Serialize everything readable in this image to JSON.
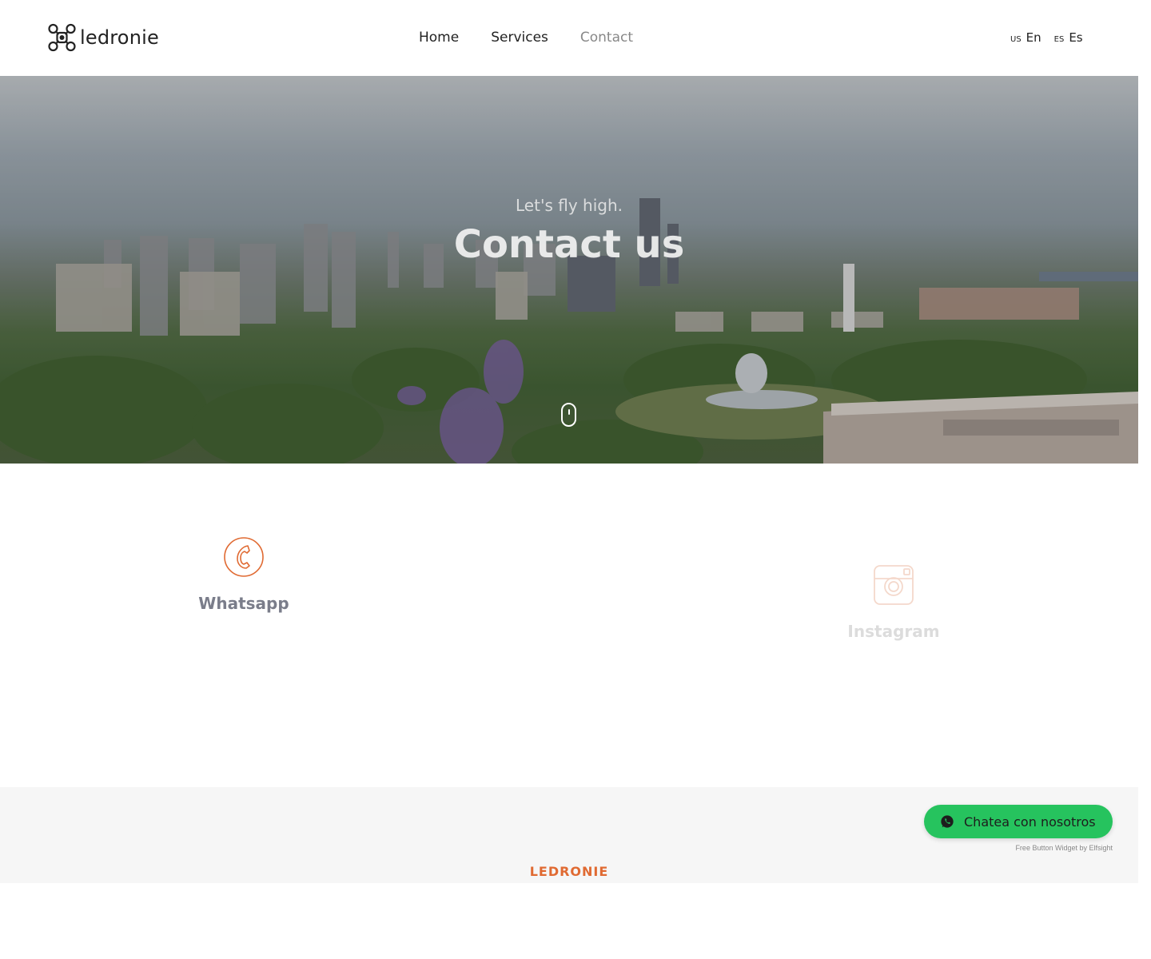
{
  "header": {
    "brand": "ledronie",
    "nav": [
      {
        "label": "Home",
        "active": false
      },
      {
        "label": "Services",
        "active": false
      },
      {
        "label": "Contact",
        "active": true
      }
    ],
    "languages": [
      {
        "code": "US",
        "label": "En"
      },
      {
        "code": "ES",
        "label": "Es"
      }
    ]
  },
  "hero": {
    "subtitle": "Let's fly high.",
    "title": "Contact us",
    "scroll_icon": "mouse-scroll-icon"
  },
  "contact": {
    "items": [
      {
        "label": "Whatsapp",
        "icon": "phone-icon"
      },
      {
        "label": "Instagram",
        "icon": "instagram-icon"
      }
    ],
    "accent_color": "#e06a32"
  },
  "footer": {
    "brand": "LEDRONIE"
  },
  "chat_widget": {
    "label": "Chatea con nosotros",
    "icon": "whatsapp-icon",
    "credit": "Free Button Widget by Elfsight",
    "color": "#26c35e"
  }
}
